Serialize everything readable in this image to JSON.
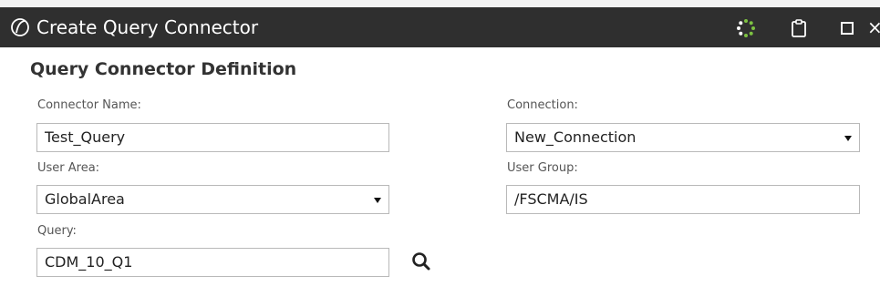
{
  "window": {
    "title": "Create Query Connector",
    "icons": [
      "app-logo-icon",
      "busy-spinner-icon",
      "clipboard-icon",
      "maximize-icon",
      "close-icon"
    ],
    "close_glyph": "×"
  },
  "form": {
    "section_title": "Query Connector Definition",
    "connector_name": {
      "label": "Connector Name:",
      "value": "Test_Query"
    },
    "connection": {
      "label": "Connection:",
      "value": "New_Connection"
    },
    "user_area": {
      "label": "User Area:",
      "value": "GlobalArea"
    },
    "user_group": {
      "label": "User Group:",
      "value": "/FSCMA/IS"
    },
    "query": {
      "label": "Query:",
      "value": "CDM_10_Q1",
      "search_icon": "search-icon"
    }
  },
  "colors": {
    "titlebar_bg": "#2f2f2f",
    "spinner_green": "#7dc142",
    "field_border": "#b9b9b9"
  }
}
